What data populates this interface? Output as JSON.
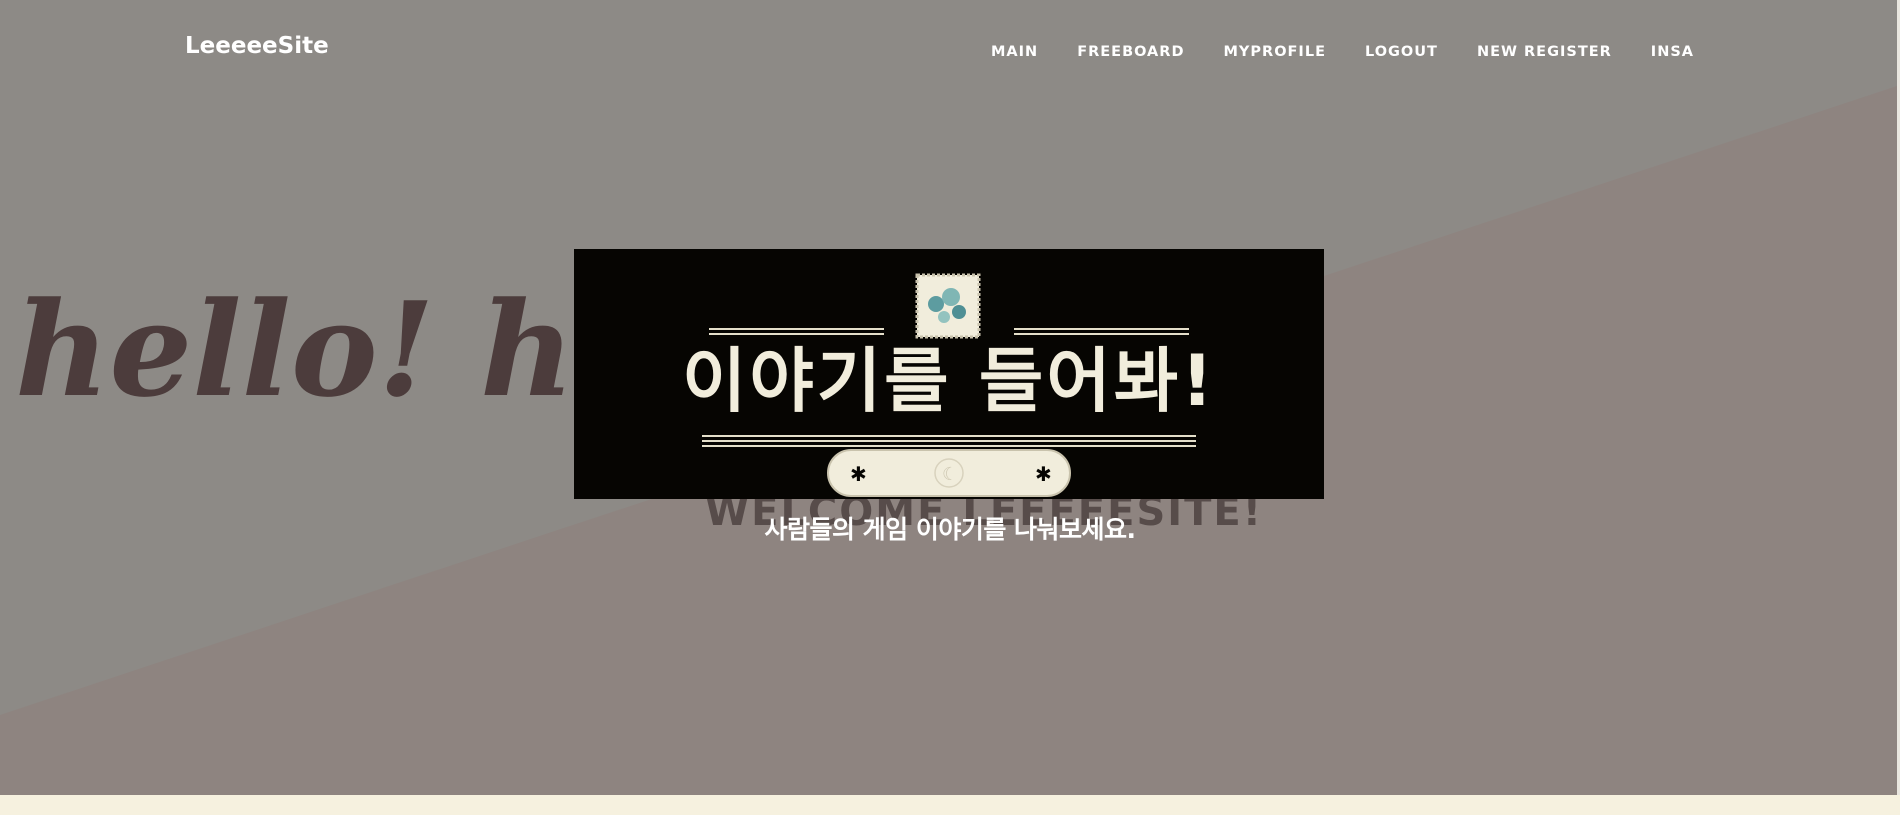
{
  "nav": {
    "brand": "LeeeeeSite",
    "links": [
      "MAIN",
      "FREEBOARD",
      "MYPROFILE",
      "LOGOUT",
      "NEW REGISTER",
      "INSA"
    ]
  },
  "hero": {
    "background_text": "hello! hello!",
    "background_colors": {
      "upper": "#8e8b86",
      "lower": "#8f8480",
      "script_text": "#3e2a2b"
    },
    "banner": {
      "title": "이야기를 들어봐!",
      "background": "#060502",
      "text_color": "#f1eddc",
      "ornaments": [
        "stamp-icon",
        "flower-icon",
        "sun-moon-icon",
        "flower-icon"
      ]
    },
    "subtitle": "사람들의 게임 이야기를 나눠보세요."
  },
  "footer": {
    "color": "#f6f1df"
  }
}
